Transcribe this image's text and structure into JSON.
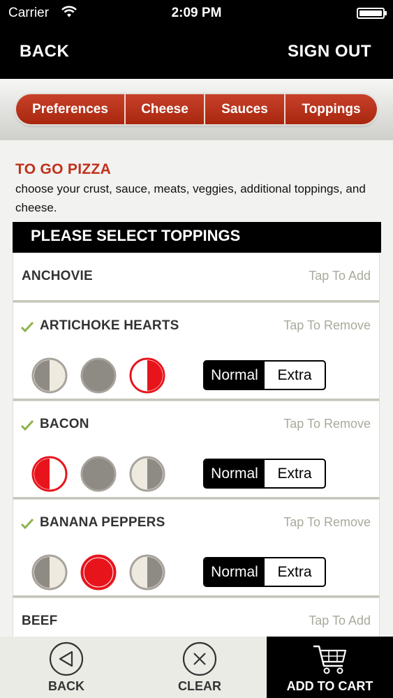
{
  "status": {
    "carrier": "Carrier",
    "time": "2:09 PM"
  },
  "nav": {
    "back": "BACK",
    "signout": "SIGN OUT"
  },
  "tabs": [
    {
      "label": "Preferences"
    },
    {
      "label": "Cheese"
    },
    {
      "label": "Sauces"
    },
    {
      "label": "Toppings"
    }
  ],
  "header": {
    "title": "TO GO PIZZA",
    "description": "choose your crust, sauce, meats, veggies, additional toppings, and cheese."
  },
  "list": {
    "heading": "PLEASE SELECT TOPPINGS",
    "items": [
      {
        "name": "ANCHOVIE",
        "action": "Tap To Add",
        "selected": false
      },
      {
        "name": "ARTICHOKE HEARTS",
        "action": "Tap To Remove",
        "selected": true,
        "portion": "right half",
        "amount": "Normal"
      },
      {
        "name": "BACON",
        "action": "Tap To Remove",
        "selected": true,
        "portion": "left half",
        "amount": "Normal"
      },
      {
        "name": "BANANA PEPPERS",
        "action": "Tap To Remove",
        "selected": true,
        "portion": "whole",
        "amount": "Normal"
      },
      {
        "name": "BEEF",
        "action": "Tap To Add",
        "selected": false
      }
    ],
    "amount_options": [
      "Normal",
      "Extra"
    ]
  },
  "toolbar": {
    "back": "BACK",
    "clear": "CLEAR",
    "add_to_cart": "ADD TO CART"
  },
  "icons": {
    "check": "checkmark-icon",
    "left_half": "left-half-portion-icon",
    "whole": "whole-portion-icon",
    "right_half": "right-half-portion-icon",
    "back": "back-arrow-circle-icon",
    "clear": "close-circle-icon",
    "cart": "shopping-cart-icon",
    "wifi": "wifi-icon",
    "battery": "battery-icon"
  },
  "colors": {
    "accent_red": "#c0301a",
    "selected_red": "#e8141c",
    "action_gray": "#a9a99c",
    "check_green": "#8cb34a"
  }
}
